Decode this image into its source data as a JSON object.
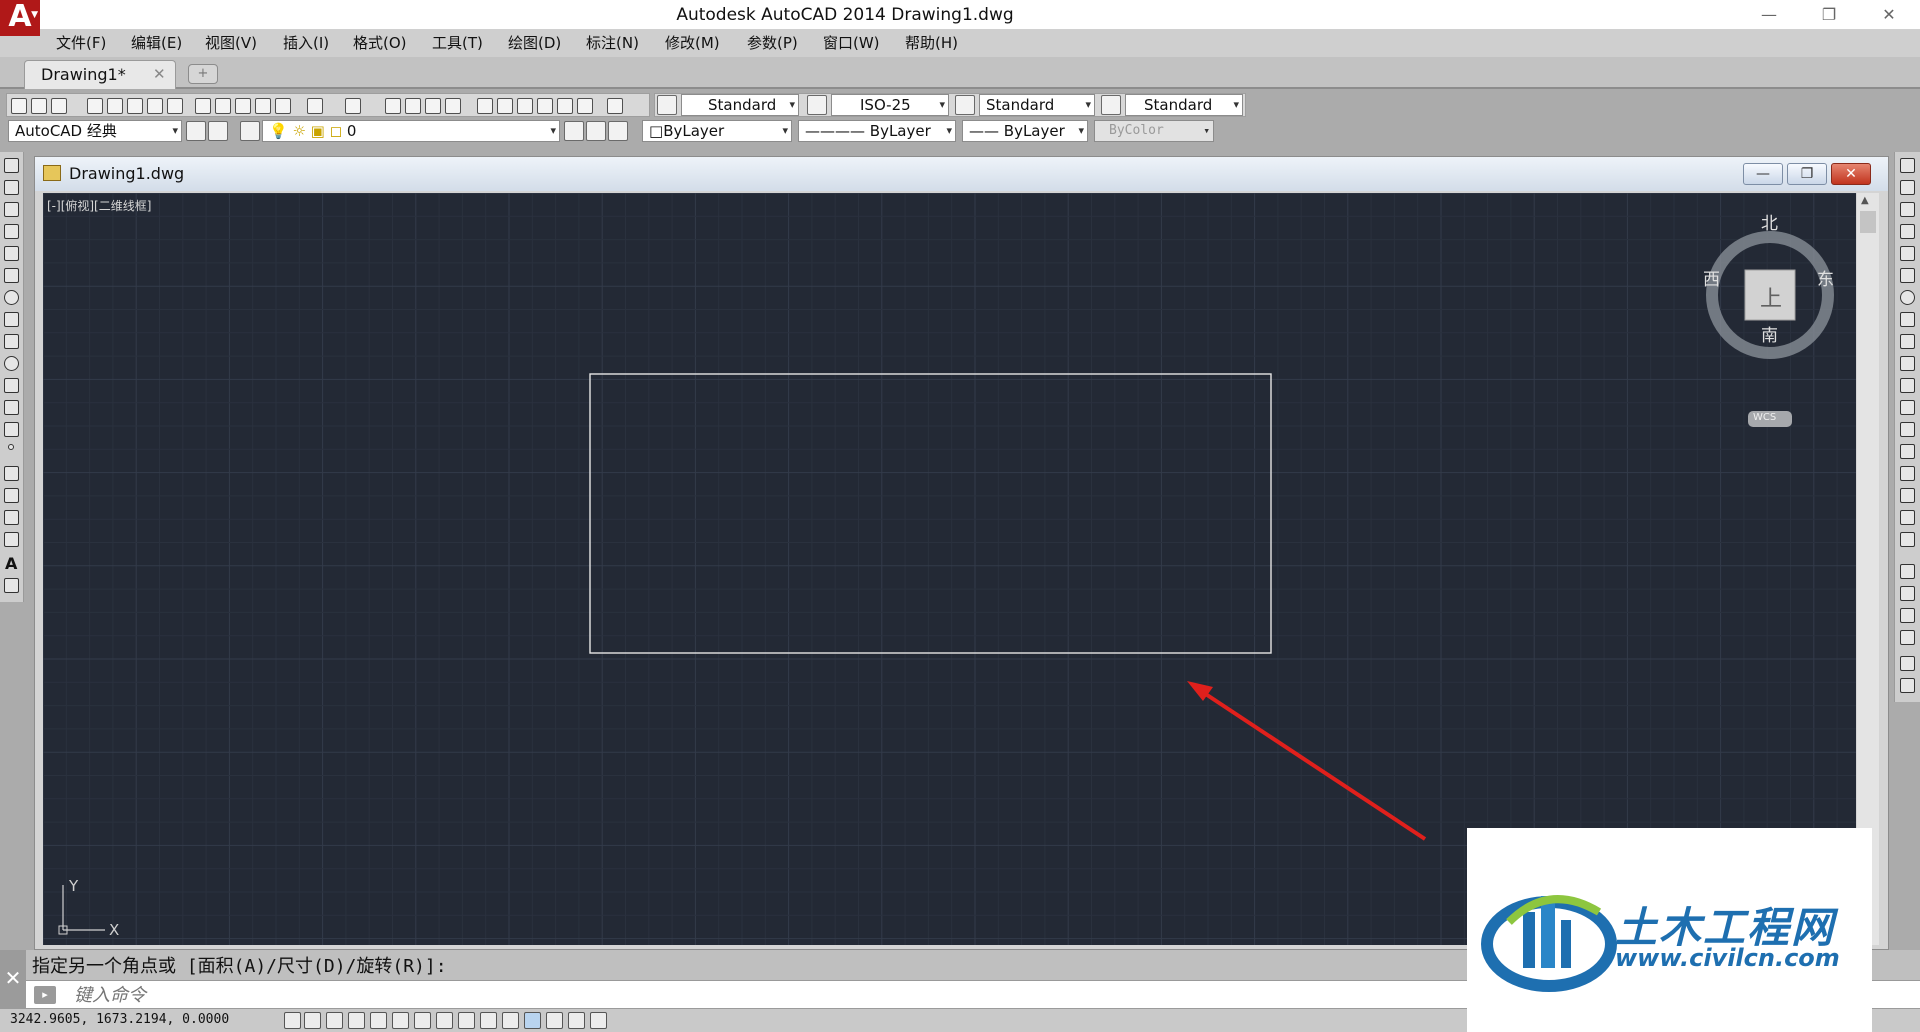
{
  "app": {
    "logo_letter": "A",
    "logo_menu_glyph": "▼",
    "title": "Autodesk AutoCAD 2014    Drawing1.dwg",
    "window_controls": {
      "minimize": "—",
      "restore": "❐",
      "close": "✕"
    }
  },
  "menubar": {
    "items": [
      {
        "label": "文件(F)"
      },
      {
        "label": "编辑(E)"
      },
      {
        "label": "视图(V)"
      },
      {
        "label": "插入(I)"
      },
      {
        "label": "格式(O)"
      },
      {
        "label": "工具(T)"
      },
      {
        "label": "绘图(D)"
      },
      {
        "label": "标注(N)"
      },
      {
        "label": "修改(M)"
      },
      {
        "label": "参数(P)"
      },
      {
        "label": "窗口(W)"
      },
      {
        "label": "帮助(H)"
      }
    ]
  },
  "tabs": {
    "active_label": "Drawing1*",
    "close_glyph": "✕",
    "new_tab_glyph": "+"
  },
  "toolbar_styles": {
    "text_style": "Standard",
    "dim_style": "ISO-25",
    "table_style": "Standard",
    "multileader_style": "Standard"
  },
  "toolbar_props": {
    "workspace": "AutoCAD 经典",
    "layer": "0",
    "color": "ByLayer",
    "linetype": "ByLayer",
    "lineweight": "ByLayer",
    "plotstyle": "ByColor",
    "dropdown_arrow": "▾"
  },
  "drawing_window": {
    "title": "Drawing1.dwg",
    "viewport_label": "[-][俯视][二维线框]",
    "buttons": {
      "minimize": "—",
      "restore": "❐",
      "close": "✕"
    }
  },
  "viewcube": {
    "north": "北",
    "south": "南",
    "east": "东",
    "west": "西",
    "face": "上",
    "wcs": "WCS"
  },
  "ucs": {
    "x_label": "X",
    "y_label": "Y"
  },
  "command": {
    "prompt_text": "指定另一个角点或 [面积(A)/尺寸(D)/旋转(R)]:",
    "input_placeholder": "键入命令",
    "close_glyph": "✕",
    "prompt_icon_glyph": "▸"
  },
  "status": {
    "coordinates": "3242.9605, 1673.2194, 0.0000"
  },
  "watermark": {
    "cn": "土木工程网",
    "en": "www.civilcn.com"
  },
  "colors": {
    "canvas": "#232935",
    "grid_minor": "#2a313e",
    "grid_major": "#333b4a",
    "rectangle": "#e6e6e6",
    "arrow": "#e0201c",
    "brand_blue": "#1e6fb0",
    "logo_red": "#b01818"
  }
}
